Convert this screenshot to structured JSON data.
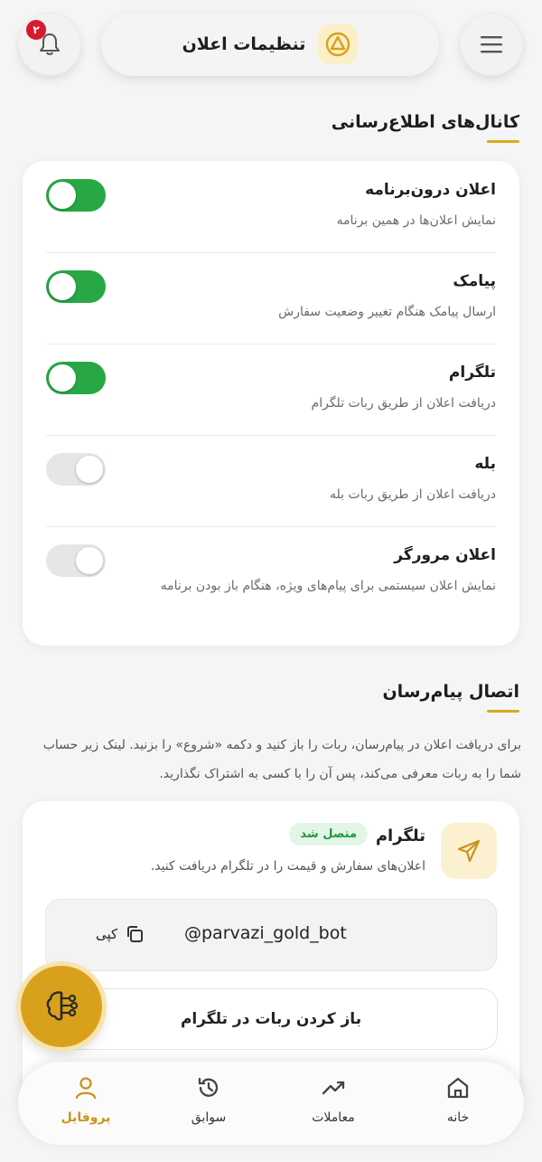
{
  "header": {
    "title": "تنظیمات اعلان",
    "notification_count": "۲",
    "menu_icon": "hamburger-icon",
    "bell_icon": "bell-icon"
  },
  "channels": {
    "section_title": "کانال‌های اطلاع‌رسانی",
    "items": [
      {
        "title": "اعلان درون‌برنامه",
        "desc": "نمایش اعلان‌ها در همین برنامه",
        "enabled": true
      },
      {
        "title": "پیامک",
        "desc": "ارسال پیامک هنگام تغییر وضعیت سفارش",
        "enabled": true
      },
      {
        "title": "تلگرام",
        "desc": "دریافت اعلان از طریق ربات تلگرام",
        "enabled": true
      },
      {
        "title": "بله",
        "desc": "دریافت اعلان از طریق ربات بله",
        "enabled": false
      },
      {
        "title": "اعلان مرورگر",
        "desc": "نمایش اعلان سیستمی برای پیام‌های ویژه، هنگام باز بودن برنامه",
        "enabled": false
      }
    ]
  },
  "messenger": {
    "section_title": "اتصال پیام‌رسان",
    "intro": "برای دریافت اعلان در پیام‌رسان، ربات را باز کنید و دکمه «شروع» را بزنید. لینک زیر حساب شما را به ربات معرفی می‌کند، پس آن را با کسی به اشتراک نگذارید.",
    "telegram": {
      "title": "تلگرام",
      "status": "متصل شد",
      "desc": "اعلان‌های سفارش و قیمت را در تلگرام دریافت کنید.",
      "bot_handle": "@parvazi_gold_bot",
      "copy_label": "کپی",
      "open_label": "باز کردن ربات در تلگرام"
    }
  },
  "nav": {
    "items": [
      {
        "label": "خانه",
        "icon": "home-icon"
      },
      {
        "label": "معاملات",
        "icon": "trend-icon"
      },
      {
        "label": "سوابق",
        "icon": "history-icon"
      },
      {
        "label": "پروفایل",
        "icon": "user-icon",
        "active": true
      }
    ]
  },
  "colors": {
    "accent": "#d9a11b",
    "toggle_on": "#27a844",
    "toggle_off": "#e5e6e8",
    "badge": "#d81b2c"
  }
}
